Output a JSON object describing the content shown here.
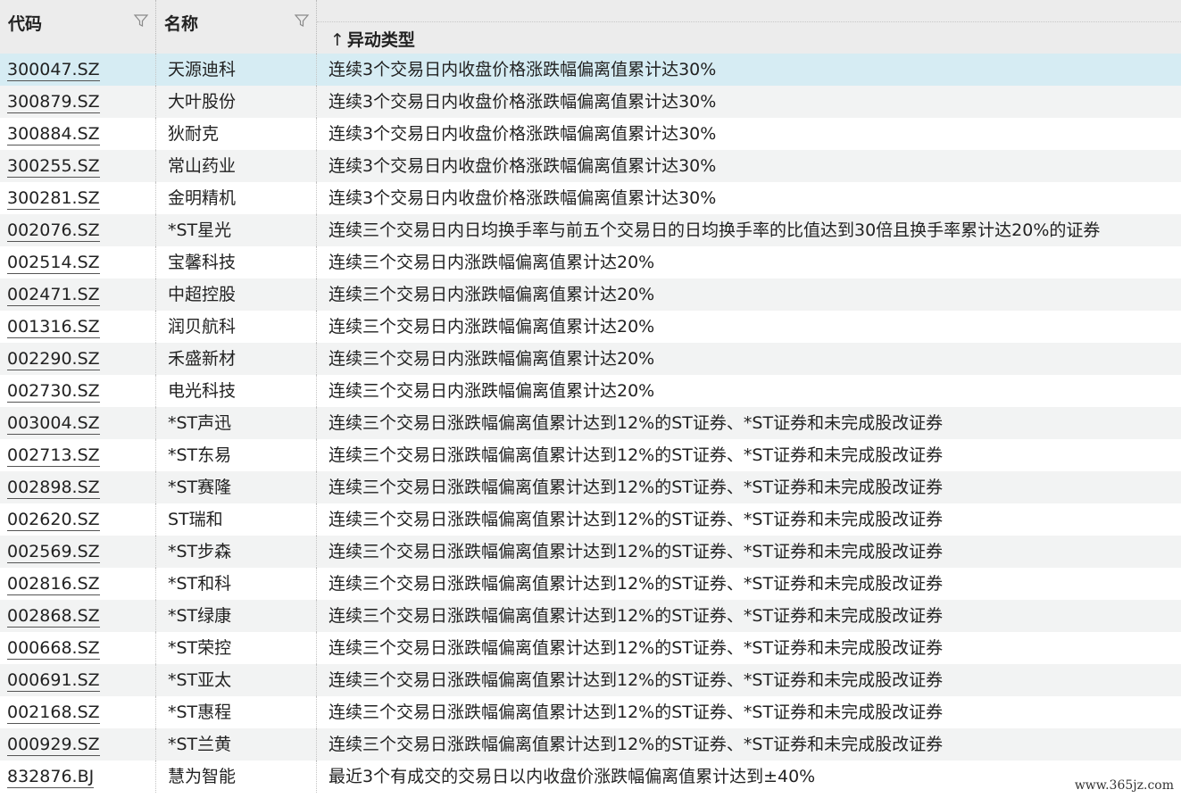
{
  "columns": {
    "code": "代码",
    "name": "名称",
    "type": "异动类型",
    "type_sort_icon": "↑"
  },
  "rows": [
    {
      "code": "300047.SZ",
      "name": "天源迪科",
      "type": "连续3个交易日内收盘价格涨跌幅偏离值累计达30%"
    },
    {
      "code": "300879.SZ",
      "name": "大叶股份",
      "type": "连续3个交易日内收盘价格涨跌幅偏离值累计达30%"
    },
    {
      "code": "300884.SZ",
      "name": "狄耐克",
      "type": "连续3个交易日内收盘价格涨跌幅偏离值累计达30%"
    },
    {
      "code": "300255.SZ",
      "name": "常山药业",
      "type": "连续3个交易日内收盘价格涨跌幅偏离值累计达30%"
    },
    {
      "code": "300281.SZ",
      "name": "金明精机",
      "type": "连续3个交易日内收盘价格涨跌幅偏离值累计达30%"
    },
    {
      "code": "002076.SZ",
      "name": "*ST星光",
      "type": "连续三个交易日内日均换手率与前五个交易日的日均换手率的比值达到30倍且换手率累计达20%的证券"
    },
    {
      "code": "002514.SZ",
      "name": "宝馨科技",
      "type": "连续三个交易日内涨跌幅偏离值累计达20%"
    },
    {
      "code": "002471.SZ",
      "name": "中超控股",
      "type": "连续三个交易日内涨跌幅偏离值累计达20%"
    },
    {
      "code": "001316.SZ",
      "name": "润贝航科",
      "type": "连续三个交易日内涨跌幅偏离值累计达20%"
    },
    {
      "code": "002290.SZ",
      "name": "禾盛新材",
      "type": "连续三个交易日内涨跌幅偏离值累计达20%"
    },
    {
      "code": "002730.SZ",
      "name": "电光科技",
      "type": "连续三个交易日内涨跌幅偏离值累计达20%"
    },
    {
      "code": "003004.SZ",
      "name": "*ST声迅",
      "type": "连续三个交易日涨跌幅偏离值累计达到12%的ST证券、*ST证券和未完成股改证券"
    },
    {
      "code": "002713.SZ",
      "name": "*ST东易",
      "type": "连续三个交易日涨跌幅偏离值累计达到12%的ST证券、*ST证券和未完成股改证券"
    },
    {
      "code": "002898.SZ",
      "name": "*ST赛隆",
      "type": "连续三个交易日涨跌幅偏离值累计达到12%的ST证券、*ST证券和未完成股改证券"
    },
    {
      "code": "002620.SZ",
      "name": "ST瑞和",
      "type": "连续三个交易日涨跌幅偏离值累计达到12%的ST证券、*ST证券和未完成股改证券"
    },
    {
      "code": "002569.SZ",
      "name": "*ST步森",
      "type": "连续三个交易日涨跌幅偏离值累计达到12%的ST证券、*ST证券和未完成股改证券"
    },
    {
      "code": "002816.SZ",
      "name": "*ST和科",
      "type": "连续三个交易日涨跌幅偏离值累计达到12%的ST证券、*ST证券和未完成股改证券"
    },
    {
      "code": "002868.SZ",
      "name": "*ST绿康",
      "type": "连续三个交易日涨跌幅偏离值累计达到12%的ST证券、*ST证券和未完成股改证券"
    },
    {
      "code": "000668.SZ",
      "name": "*ST荣控",
      "type": "连续三个交易日涨跌幅偏离值累计达到12%的ST证券、*ST证券和未完成股改证券"
    },
    {
      "code": "000691.SZ",
      "name": "*ST亚太",
      "type": "连续三个交易日涨跌幅偏离值累计达到12%的ST证券、*ST证券和未完成股改证券"
    },
    {
      "code": "002168.SZ",
      "name": "*ST惠程",
      "type": "连续三个交易日涨跌幅偏离值累计达到12%的ST证券、*ST证券和未完成股改证券"
    },
    {
      "code": "000929.SZ",
      "name": "*ST兰黄",
      "type": "连续三个交易日涨跌幅偏离值累计达到12%的ST证券、*ST证券和未完成股改证券"
    },
    {
      "code": "832876.BJ",
      "name": "慧为智能",
      "type": "最近3个有成交的交易日以内收盘价涨跌幅偏离值累计达到±40%"
    }
  ],
  "watermark": "www.365jz.com",
  "icons": {
    "filter": "filter-icon"
  },
  "colors": {
    "header_bg": "#ececec",
    "selected_row": "#d6ecf3",
    "alt_row": "#f2f3f3"
  }
}
